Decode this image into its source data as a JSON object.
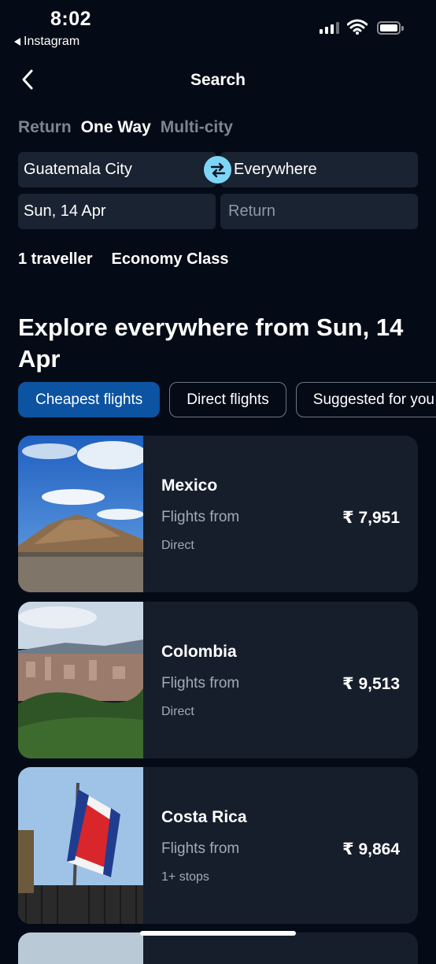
{
  "status_bar": {
    "time": "8:02",
    "back_app": "Instagram"
  },
  "nav": {
    "title": "Search"
  },
  "trip_types": [
    "Return",
    "One Way",
    "Multi-city"
  ],
  "search": {
    "origin": "Guatemala City",
    "destination": "Everywhere",
    "depart_date": "Sun, 14 Apr",
    "return_placeholder": "Return",
    "travellers": "1 traveller",
    "cabin": "Economy Class"
  },
  "explore": {
    "heading": "Explore everywhere from Sun, 14 Apr",
    "filters": [
      "Cheapest flights",
      "Direct flights",
      "Suggested for you"
    ]
  },
  "results": [
    {
      "country": "Mexico",
      "from_label": "Flights from",
      "price": "₹ 7,951",
      "stops": "Direct"
    },
    {
      "country": "Colombia",
      "from_label": "Flights from",
      "price": "₹ 9,513",
      "stops": "Direct"
    },
    {
      "country": "Costa Rica",
      "from_label": "Flights from",
      "price": "₹ 9,864",
      "stops": "1+ stops"
    }
  ],
  "colors": {
    "background": "#050b16",
    "card": "#161e2b",
    "accent": "#7ed6f7",
    "chip_selected": "#0c53a2"
  }
}
